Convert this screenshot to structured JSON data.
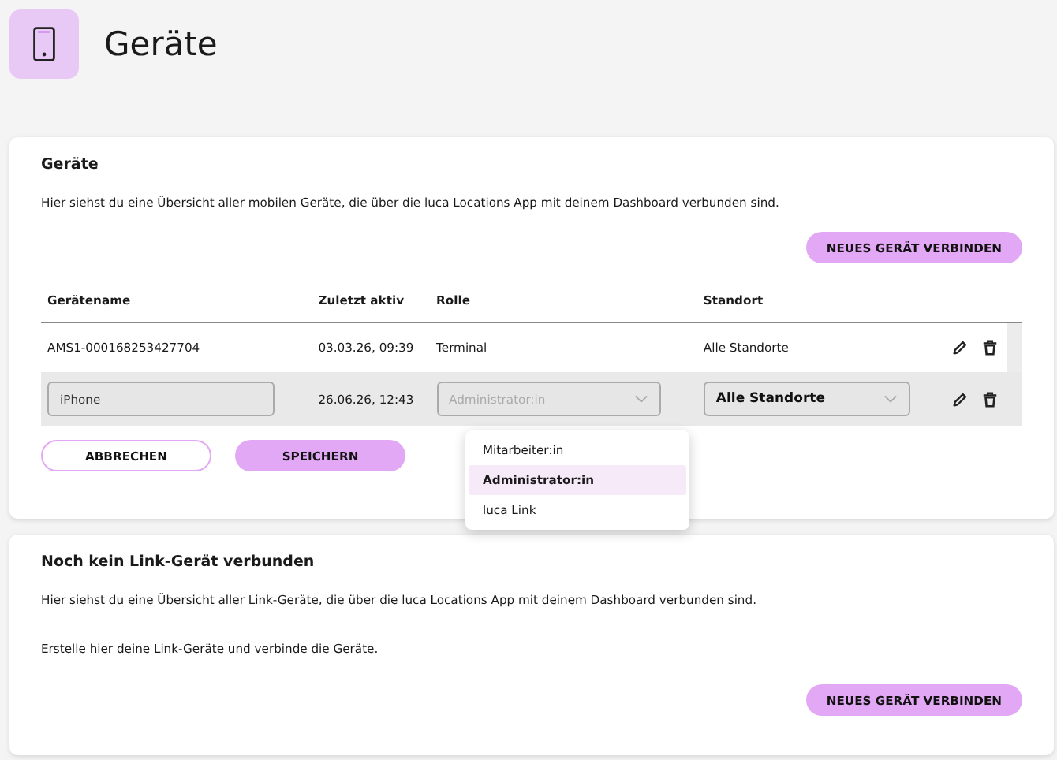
{
  "header": {
    "title": "Geräte"
  },
  "devices_card": {
    "title": "Geräte",
    "description": "Hier siehst du eine Übersicht aller mobilen Geräte, die über die luca Locations App mit deinem Dashboard verbunden sind.",
    "connect_button": "NEUES GERÄT VERBINDEN",
    "table": {
      "columns": [
        "Gerätename",
        "Zuletzt aktiv",
        "Rolle",
        "Standort"
      ],
      "rows": [
        {
          "kind": "view",
          "name": "AMS1-000168253427704",
          "last_active": "03.03.26, 09:39",
          "role": "Terminal",
          "location": "Alle Standorte"
        },
        {
          "kind": "edit",
          "name": "iPhone",
          "last_active": "26.06.26, 12:43",
          "role": "Administrator:in",
          "role_disabled": true,
          "location": "Alle Standorte",
          "location_disabled": false
        }
      ]
    },
    "role_menu": [
      {
        "label": "Mitarbeiter:in",
        "selected": false
      },
      {
        "label": "Administrator:in",
        "selected": true
      },
      {
        "label": "luca Link",
        "selected": false
      }
    ],
    "cancel_button": "ABBRECHEN",
    "save_button": "SPEICHERN"
  },
  "link_card": {
    "title": "Noch kein Link-Gerät verbunden",
    "paragraphs": [
      "Hier siehst du eine Übersicht aller Link-Geräte, die über die luca Locations App mit deinem Dashboard verbunden sind.",
      "Erstelle hier deine Link-Geräte und verbinde die Geräte."
    ],
    "connect_button": "NEUES GERÄT VERBINDEN"
  }
}
